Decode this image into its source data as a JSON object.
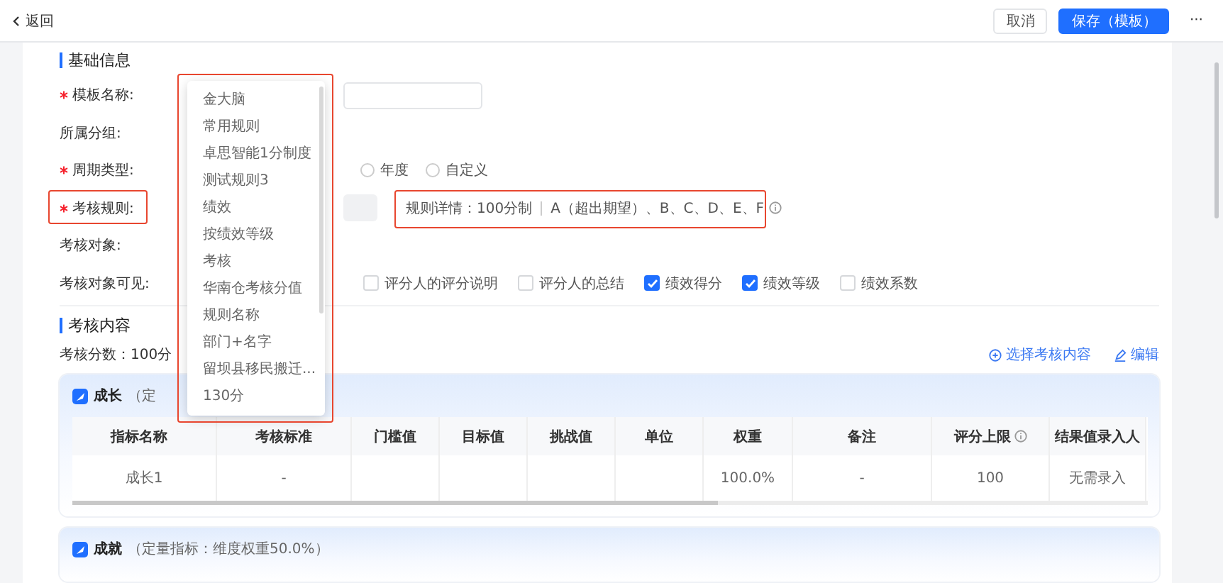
{
  "topbar": {
    "back": "返回",
    "buttons": [
      {
        "label": "取消",
        "kind": "default"
      },
      {
        "label": "保存（模板）",
        "kind": "primary"
      }
    ],
    "more": "···"
  },
  "basic": {
    "title": "基础信息",
    "fields": [
      {
        "label": "模板名称:",
        "required": true,
        "kind": "input"
      },
      {
        "label": "所属分组:",
        "required": false,
        "kind": "empty"
      },
      {
        "label": "周期类型:",
        "required": true,
        "kind": "radio",
        "options": [
          {
            "label": "年度",
            "selected": false
          },
          {
            "label": "自定义",
            "selected": false
          }
        ]
      },
      {
        "label": "考核规则:",
        "required": true,
        "kind": "rule",
        "detail_label": "规则详情：100分制",
        "detail_value": "A（超出期望）、B、C、D、E、F"
      },
      {
        "label": "考核对象:",
        "required": false,
        "kind": "empty"
      },
      {
        "label": "考核对象可见:",
        "required": false,
        "kind": "checks",
        "options": [
          {
            "label": "评分人的评分说明",
            "checked": false
          },
          {
            "label": "评分人的总结",
            "checked": false
          },
          {
            "label": "绩效得分",
            "checked": true
          },
          {
            "label": "绩效等级",
            "checked": true
          },
          {
            "label": "绩效系数",
            "checked": false
          }
        ]
      }
    ]
  },
  "content": {
    "title": "考核内容",
    "score": "考核分数：100分",
    "actions": [
      {
        "label": "选择考核内容",
        "kind": "add"
      },
      {
        "label": "编辑",
        "kind": "edit"
      }
    ],
    "groups": [
      {
        "name": "成长",
        "subtitle": "（定",
        "columns": [
          "指标名称",
          "考核标准",
          "门槛值",
          "目标值",
          "挑战值",
          "单位",
          "权重",
          "备注",
          "评分上限",
          "结果值录入人"
        ],
        "rows": [
          [
            "成长1",
            "-",
            "",
            "",
            "",
            "",
            "100.0%",
            "-",
            "100",
            "无需录入"
          ]
        ]
      },
      {
        "name": "成就",
        "subtitle": "（定量指标：维度权重50.0%）"
      }
    ]
  },
  "dropdown": {
    "items": [
      "金大脑",
      "常用规则",
      "卓思智能1分制度",
      "测试规则3",
      "绩效",
      "按绩效等级",
      "考核",
      "华南仓考核分值",
      "规则名称",
      "部门+名字",
      "留坝县移民搬迁...",
      "130分"
    ]
  }
}
